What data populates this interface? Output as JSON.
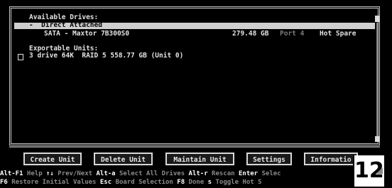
{
  "drives": {
    "heading": "Available Drives:",
    "group_label": "-  Direct Attached",
    "disk": {
      "name": "SATA - Maxtor 7B300S0",
      "size": "279.48 GB",
      "port": "Port 4",
      "status": "Hot Spare"
    }
  },
  "units": {
    "heading": "Exportable Units:",
    "item": "3 drive 64K  RAID 5 558.77 GB (Unit 0)"
  },
  "buttons": {
    "create": "Create Unit",
    "delete": "Delete Unit",
    "maintain": "Maintain Unit",
    "settings": "Settings",
    "information": "Informatio"
  },
  "status_line1": [
    {
      "k": "Alt-F1",
      "d": " Help "
    },
    {
      "k": "↑↓",
      "d": " Prev/Next "
    },
    {
      "k": "Alt-a",
      "d": " Select All Drives "
    },
    {
      "k": "Alt-r",
      "d": " Rescan "
    },
    {
      "k": "Enter",
      "d": " Selec"
    }
  ],
  "status_line2": [
    {
      "k": "F6",
      "d": " Restore Initial Values "
    },
    {
      "k": "Esc",
      "d": " Board Selection "
    },
    {
      "k": "F8",
      "d": " Done "
    },
    {
      "k": "s",
      "d": " Toggle Hot S"
    }
  ],
  "badge": "12"
}
